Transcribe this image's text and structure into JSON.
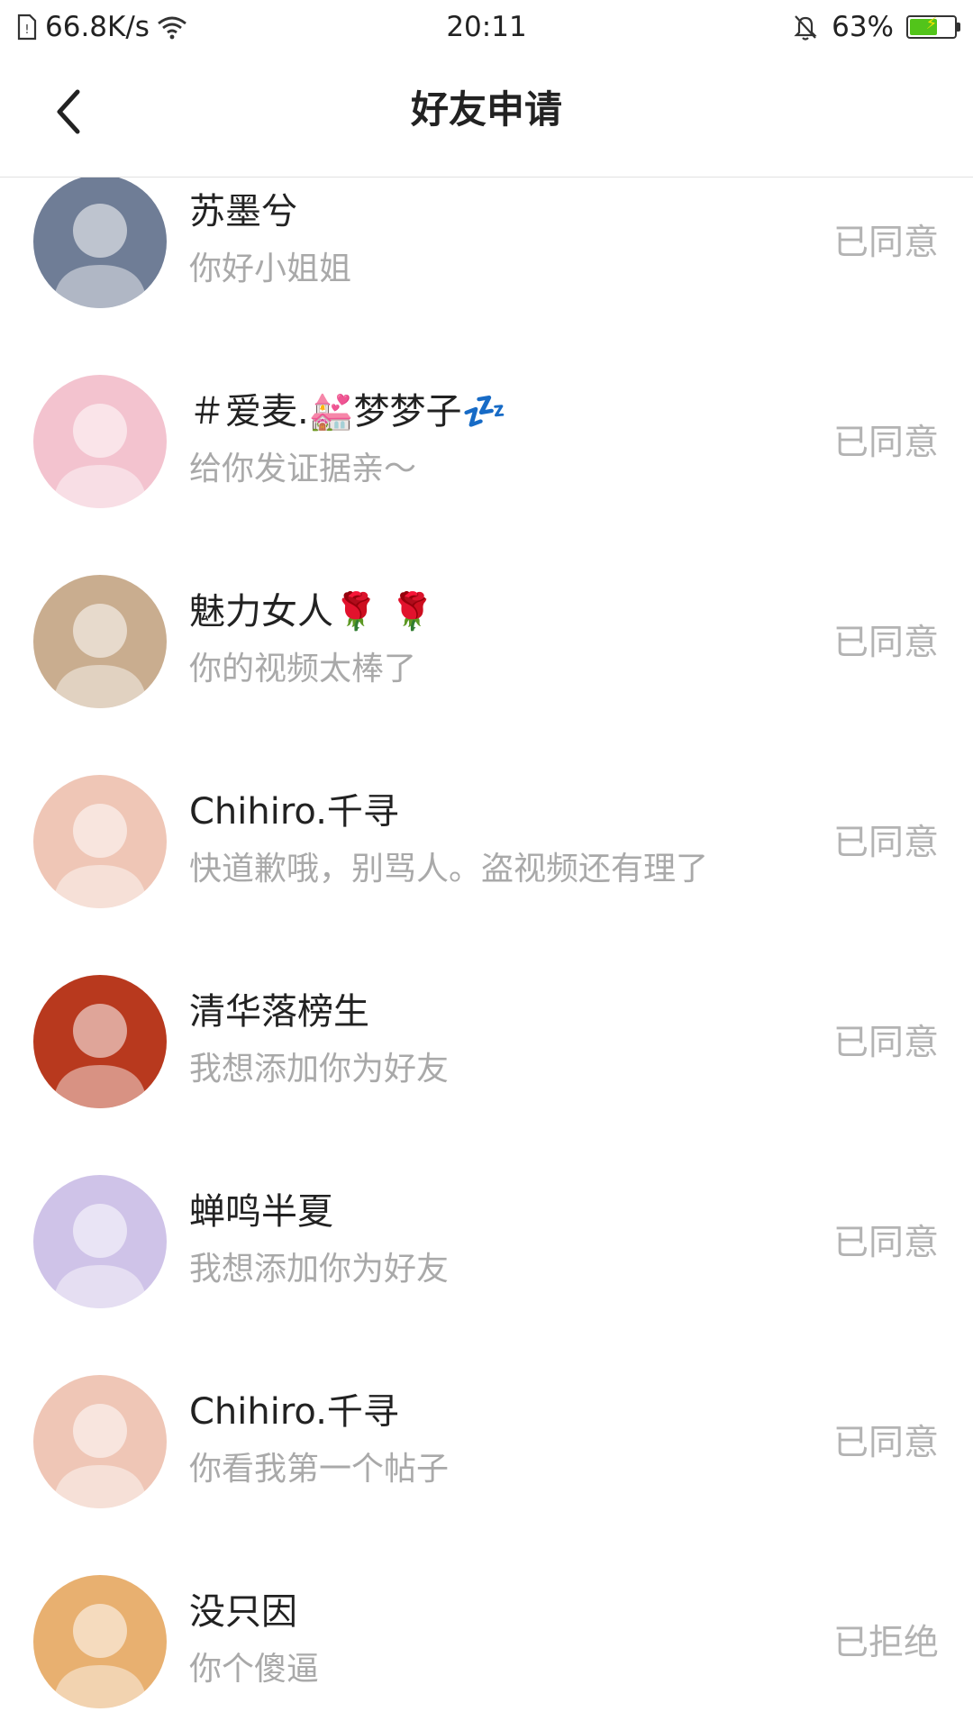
{
  "status_bar": {
    "network_speed": "66.8K/s",
    "time": "20:11",
    "battery_percent": "63%",
    "battery_level": 0.63,
    "icons": [
      "sim-icon",
      "wifi-icon",
      "bell-muted-icon",
      "battery-charging-icon"
    ]
  },
  "header": {
    "title": "好友申请"
  },
  "requests": [
    {
      "name": "苏墨兮",
      "message": "你好小姐姐",
      "status": "已同意",
      "avatar_color": "#6f7d96"
    },
    {
      "name": "＃爱麦.💒梦梦子💤",
      "message": "给你发证据亲～",
      "status": "已同意",
      "avatar_color": "#f3c3cf"
    },
    {
      "name": "魅力女人🌹 🌹",
      "message": "你的视频太棒了",
      "status": "已同意",
      "avatar_color": "#c9ad8f"
    },
    {
      "name": "Chihiro.千寻",
      "message": "快道歉哦，别骂人。盗视频还有理了",
      "status": "已同意",
      "avatar_color": "#efc6b6"
    },
    {
      "name": "清华落榜生",
      "message": "我想添加你为好友",
      "status": "已同意",
      "avatar_color": "#b8391e"
    },
    {
      "name": "蝉鸣半夏",
      "message": "我想添加你为好友",
      "status": "已同意",
      "avatar_color": "#cfc3e8"
    },
    {
      "name": "Chihiro.千寻",
      "message": "你看我第一个帖子",
      "status": "已同意",
      "avatar_color": "#efc6b6"
    },
    {
      "name": "没只因",
      "message": "你个傻逼",
      "status": "已拒绝",
      "avatar_color": "#e8b070"
    }
  ],
  "colors": {
    "name_text": "#222222",
    "message_text": "#a9a9a9",
    "status_text": "#b3b3b3",
    "battery_fill": "#52c41a"
  }
}
